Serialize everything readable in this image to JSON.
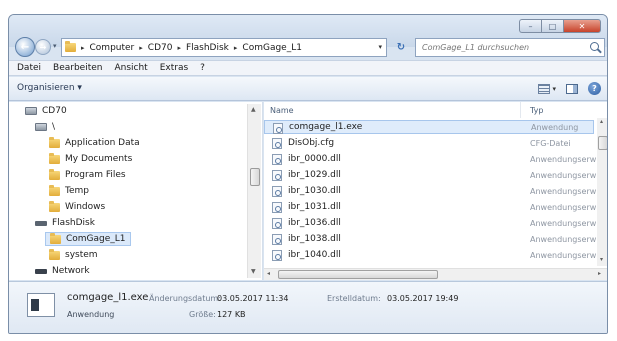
{
  "window": {
    "controls": {
      "minimize": "–",
      "maximize": "□",
      "close": "✕"
    }
  },
  "nav": {
    "back_glyph": "←",
    "forward_glyph": "→",
    "dropdown_glyph": "▾"
  },
  "address": {
    "crumbs": [
      "Computer",
      "CD70",
      "FlashDisk",
      "ComGage_L1"
    ],
    "separator": "▸",
    "dropdown_glyph": "▾",
    "refresh_glyph": "↻"
  },
  "search": {
    "placeholder": "ComGage_L1 durchsuchen"
  },
  "menu": {
    "items": [
      "Datei",
      "Bearbeiten",
      "Ansicht",
      "Extras",
      "?"
    ]
  },
  "toolbar": {
    "organize_label": "Organisieren ▾",
    "view_dropdown": "▾",
    "help_label": "?"
  },
  "navpane": {
    "items": [
      {
        "label": "CD70",
        "icon": "drive-icon"
      },
      {
        "label": "\\",
        "icon": "drive-icon"
      },
      {
        "label": "Application Data",
        "icon": "folder-icon"
      },
      {
        "label": "My Documents",
        "icon": "folder-icon"
      },
      {
        "label": "Program Files",
        "icon": "folder-icon"
      },
      {
        "label": "Temp",
        "icon": "folder-icon"
      },
      {
        "label": "Windows",
        "icon": "folder-icon"
      },
      {
        "label": "FlashDisk",
        "icon": "usb-icon"
      },
      {
        "label": "ComGage_L1",
        "icon": "folder-icon",
        "selected": true
      },
      {
        "label": "system",
        "icon": "folder-icon"
      },
      {
        "label": "Network",
        "icon": "net-icon"
      }
    ],
    "scroll_up": "▲",
    "scroll_down": "▼"
  },
  "filepane": {
    "columns": {
      "name": "Name",
      "type": "Typ"
    },
    "files": [
      {
        "name": "comgage_l1.exe",
        "type": "Anwendung",
        "selected": true
      },
      {
        "name": "DisObj.cfg",
        "type": "CFG-Datei"
      },
      {
        "name": "ibr_0000.dll",
        "type": "Anwendungserw"
      },
      {
        "name": "ibr_1029.dll",
        "type": "Anwendungserw"
      },
      {
        "name": "ibr_1030.dll",
        "type": "Anwendungserw"
      },
      {
        "name": "ibr_1031.dll",
        "type": "Anwendungserw"
      },
      {
        "name": "ibr_1036.dll",
        "type": "Anwendungserw"
      },
      {
        "name": "ibr_1038.dll",
        "type": "Anwendungserw"
      },
      {
        "name": "ibr_1040.dll",
        "type": "Anwendungserw"
      }
    ],
    "scroll_left": "◂",
    "scroll_right": "▸",
    "scroll_up": "▴",
    "scroll_down": "▾"
  },
  "details": {
    "filename": "comgage_l1.exe",
    "type": "Anwendung",
    "modified_label": "Änderungsdatum:",
    "modified_value": "03.05.2017 11:34",
    "created_label": "Erstelldatum:",
    "created_value": "03.05.2017 19:49",
    "size_label": "Größe:",
    "size_value": "127 KB"
  }
}
